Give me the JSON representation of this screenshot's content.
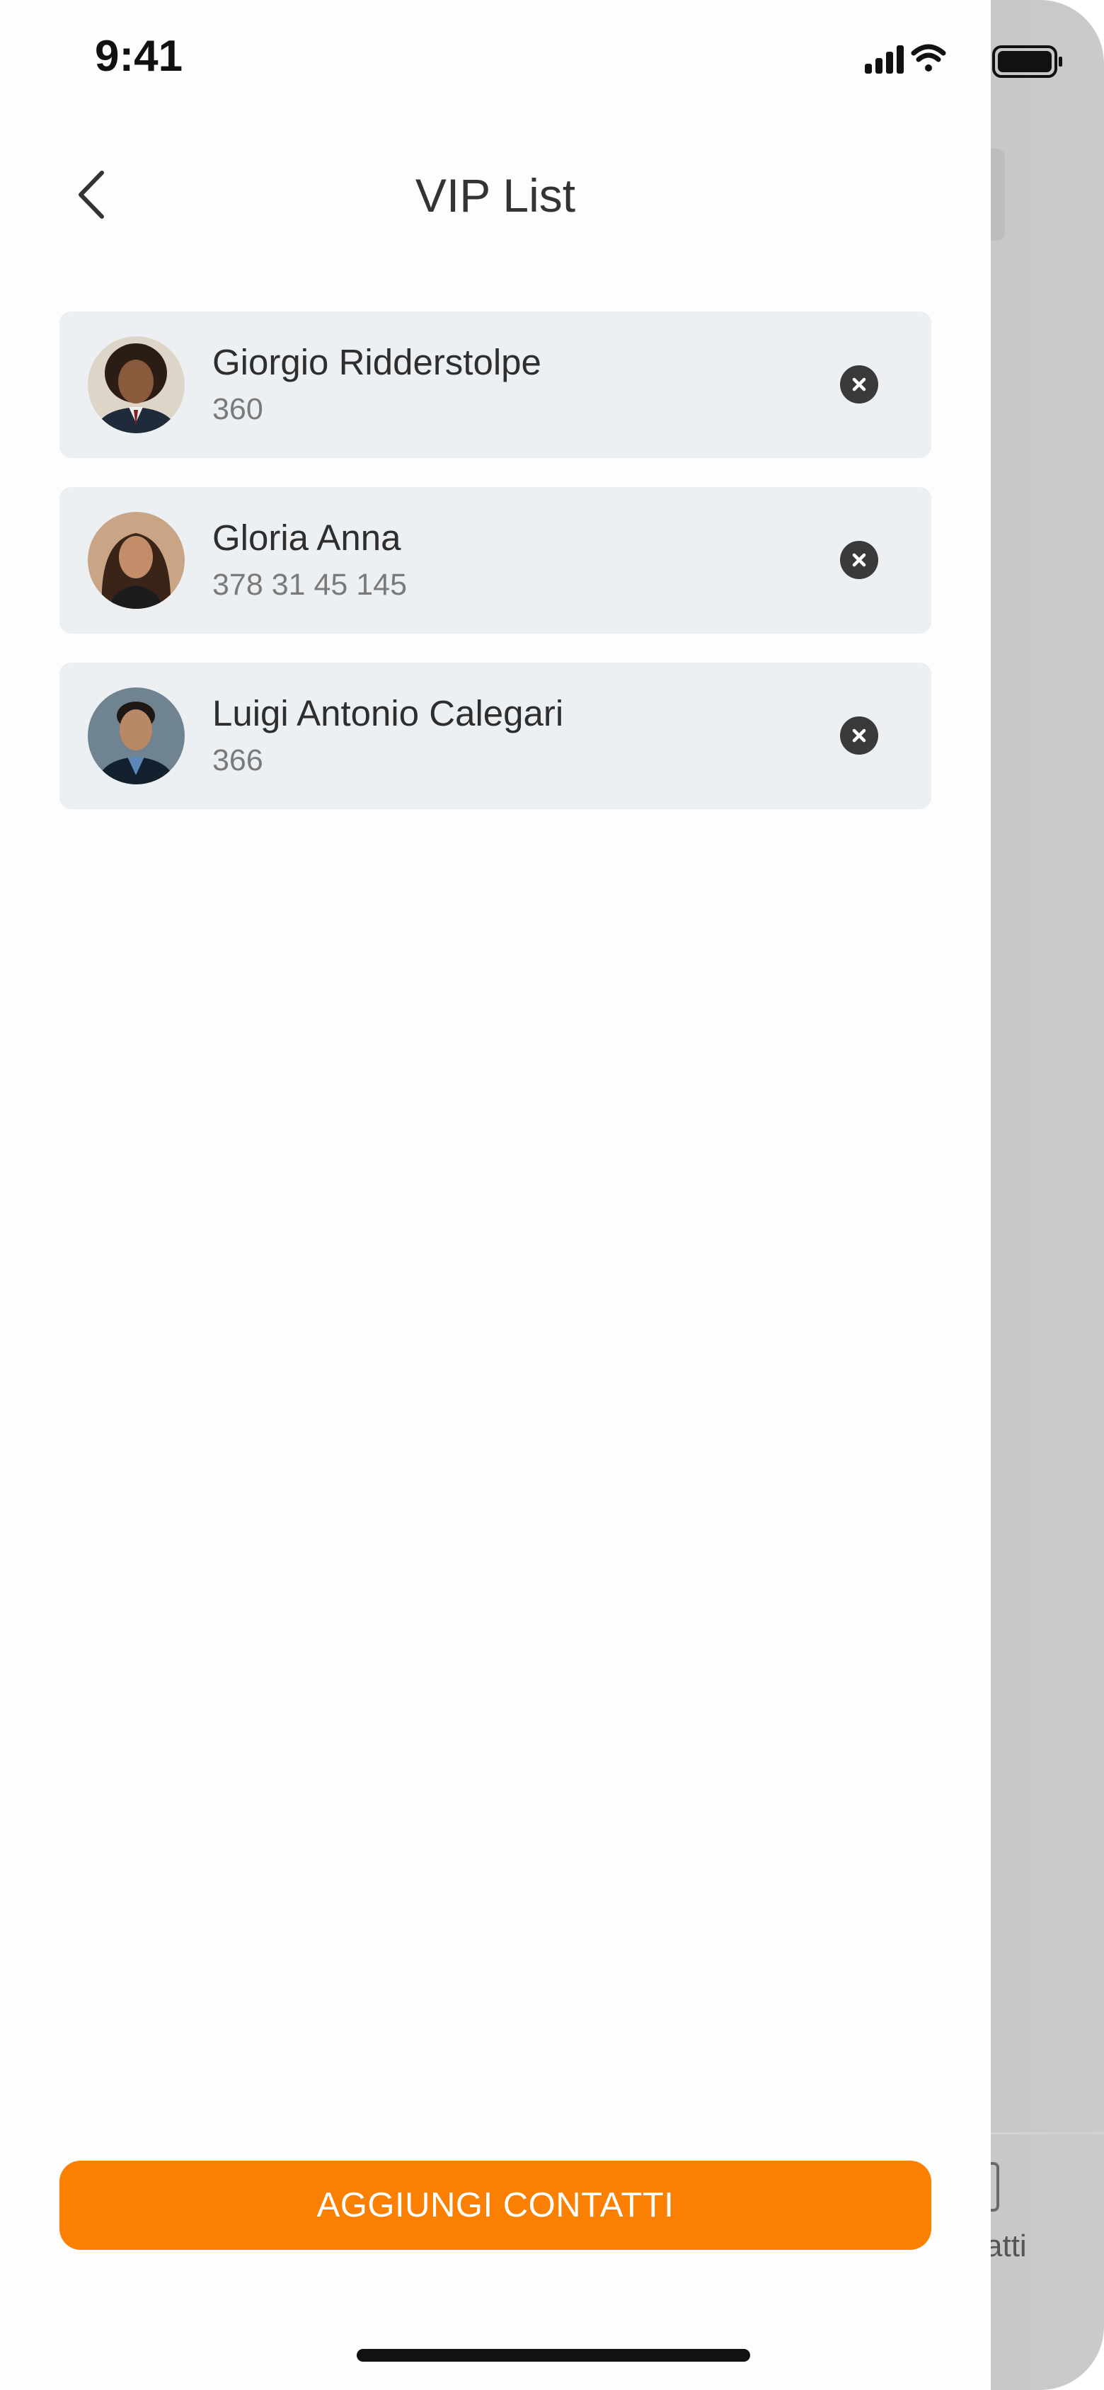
{
  "status_bar": {
    "time": "9:41"
  },
  "header": {
    "title": "VIP List"
  },
  "contacts": [
    {
      "name": "Giorgio Ridderstolpe",
      "phone": "360"
    },
    {
      "name": "Gloria Anna",
      "phone": "378 31 45 145"
    },
    {
      "name": "Luigi Antonio Calegari",
      "phone": "366"
    }
  ],
  "footer": {
    "add_button_label": "AGGIUNGI CONTATTI"
  },
  "background_screen": {
    "tab_label_partial": "atti"
  },
  "colors": {
    "accent": "#fb7f00",
    "card_background": "#edf0f3",
    "remove_button": "#3a3a3a"
  }
}
